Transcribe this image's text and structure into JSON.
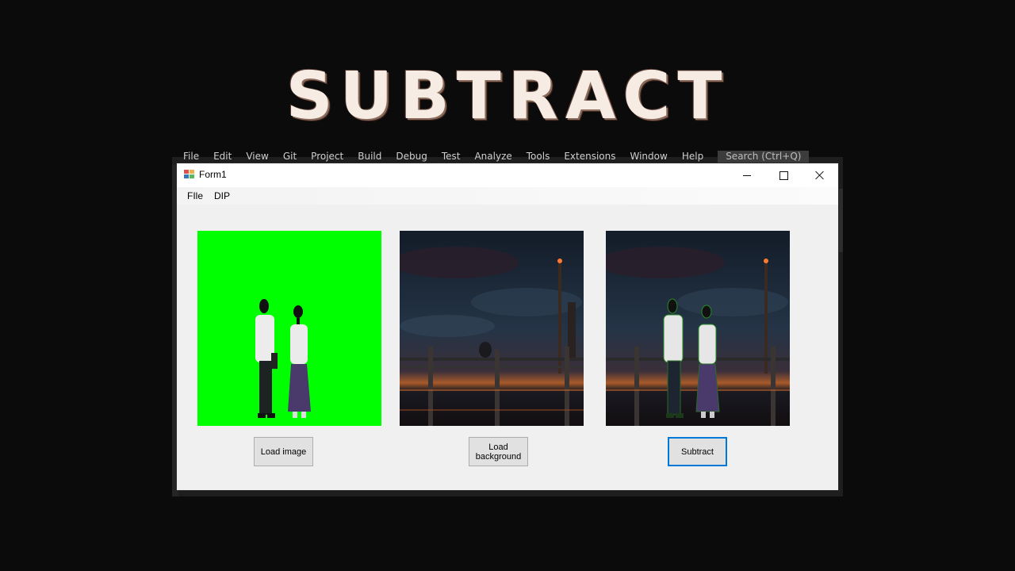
{
  "headline": "SUBTRACT",
  "ide": {
    "menu": [
      "File",
      "Edit",
      "View",
      "Git",
      "Project",
      "Build",
      "Debug",
      "Test",
      "Analyze",
      "Tools",
      "Extensions",
      "Window",
      "Help"
    ],
    "search_placeholder": "Search (Ctrl+Q)"
  },
  "window": {
    "title": "Form1",
    "menu": {
      "file": "FIle",
      "dip": "DIP"
    },
    "buttons": {
      "load_image": "Load image",
      "load_background": "Load background",
      "subtract": "Subtract"
    }
  },
  "colors": {
    "greenscreen": "#00ff00",
    "focus_border": "#0078d7",
    "night_sky": "#1c2a38"
  },
  "icons": [
    "app-icon",
    "minimize-icon",
    "maximize-icon",
    "close-icon"
  ]
}
